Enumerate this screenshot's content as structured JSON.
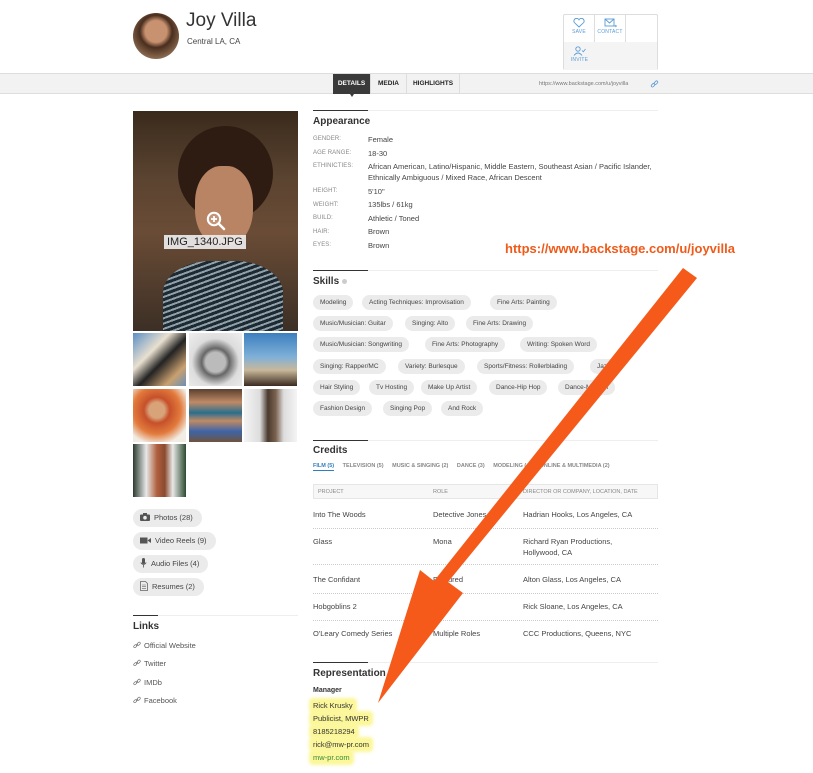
{
  "profile": {
    "name": "Joy Villa",
    "location": "Central LA, CA"
  },
  "actions": {
    "save": {
      "label": "SAVE",
      "icon": "heart-icon"
    },
    "contact": {
      "label": "CONTACT",
      "icon": "envelope-icon"
    },
    "invite": {
      "label": "INVITE",
      "icon": "user-check-icon"
    }
  },
  "tabs": [
    {
      "label": "DETAILS",
      "active": true
    },
    {
      "label": "MEDIA",
      "active": false
    },
    {
      "label": "HIGHLIGHTS",
      "active": false
    }
  ],
  "profile_url": "https://www.backstage.com/u/joyvilla",
  "main_photo": {
    "filename": "IMG_1340.JPG",
    "icon": "zoom-in-icon"
  },
  "thumbnails": [
    "photo-2",
    "photo-3",
    "photo-4",
    "photo-5",
    "photo-6",
    "photo-7",
    "photo-8"
  ],
  "media_links": [
    {
      "label": "Photos (28)",
      "icon": "camera-icon"
    },
    {
      "label": "Video Reels (9)",
      "icon": "video-camera-icon"
    },
    {
      "label": "Audio Files (4)",
      "icon": "microphone-icon"
    },
    {
      "label": "Resumes (2)",
      "icon": "document-icon"
    }
  ],
  "links": {
    "title": "Links",
    "items": [
      "Official Website",
      "Twitter",
      "IMDb",
      "Facebook"
    ]
  },
  "appearance": {
    "title": "Appearance",
    "rows": [
      {
        "label": "GENDER:",
        "value": "Female"
      },
      {
        "label": "AGE RANGE:",
        "value": "18-30"
      },
      {
        "label": "ETHINICTIES:",
        "value": "African American, Latino/Hispanic, Middle Eastern, Southeast Asian / Pacific Islander, Ethnically Ambiguous / Mixed Race, African Descent"
      },
      {
        "label": "HEIGHT:",
        "value": "5'10\""
      },
      {
        "label": "WEIGHT:",
        "value": "135lbs / 61kg"
      },
      {
        "label": "BUILD:",
        "value": "Athletic / Toned"
      },
      {
        "label": "HAIR:",
        "value": "Brown"
      },
      {
        "label": "EYES:",
        "value": "Brown"
      }
    ]
  },
  "skills": {
    "title": "Skills",
    "items": [
      "Modeling",
      "Acting Techniques: Improvisation",
      "Fine Arts: Painting",
      "Music/Musician: Guitar",
      "Singing: Alto",
      "Fine Arts: Drawing",
      "Music/Musician: Songwriting",
      "Fine Arts: Photography",
      "Writing: Spoken Word",
      "Singing: Rapper/MC",
      "Variety: Burlesque",
      "Sports/Fitness: Rollerblading",
      "Jazz",
      "Hair Styling",
      "Tv Hosting",
      "Make Up Artist",
      "Dance-Hip Hop",
      "Dance-Modern",
      "Fashion Design",
      "Singing Pop",
      "And Rock"
    ]
  },
  "credits": {
    "title": "Credits",
    "tabs": [
      {
        "label": "FILM (5)",
        "active": true
      },
      {
        "label": "TELEVISION (5)",
        "active": false
      },
      {
        "label": "MUSIC & SINGING (2)",
        "active": false
      },
      {
        "label": "DANCE (3)",
        "active": false
      },
      {
        "label": "MODELING (4)",
        "active": false
      },
      {
        "label": "ONLINE & MULTIMEDIA (2)",
        "active": false
      }
    ],
    "columns": [
      "PROJECT",
      "ROLE",
      "DIRECTOR OR COMPANY, LOCATION, DATE"
    ],
    "rows": [
      {
        "project": "Into The Woods",
        "role": "Detective Jones",
        "director": "Hadrian Hooks, Los Angeles, CA"
      },
      {
        "project": "Glass",
        "role": "Mona",
        "director": "Richard Ryan Productions, Hollywood, CA"
      },
      {
        "project": "The Confidant",
        "role": "Featured",
        "director": "Alton Glass, Los Angeles, CA"
      },
      {
        "project": "Hobgoblins 2",
        "role": "",
        "director": "Rick Sloane, Los Angeles, CA"
      },
      {
        "project": "O'Leary Comedy Series",
        "role": "Multiple Roles",
        "director": "CCC Productions, Queens, NYC"
      }
    ]
  },
  "representation": {
    "title": "Representation",
    "type": "Manager",
    "name": "Rick Krusky",
    "company": "Publicist, MWPR",
    "phone": "8185218294",
    "email": "rick@mw-pr.com",
    "website": "mw-pr.com"
  },
  "annotation": {
    "text": "https://www.backstage.com/u/joyvilla",
    "color": "#f05a1a"
  }
}
